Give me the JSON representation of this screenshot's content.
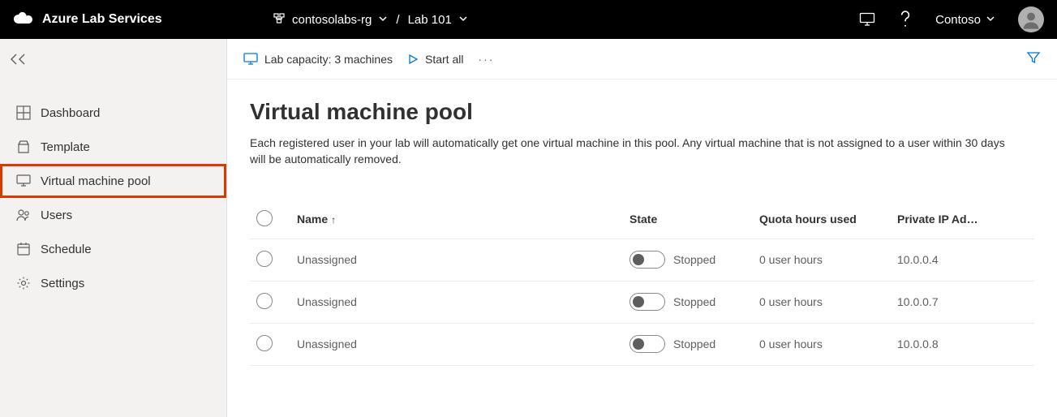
{
  "brand": "Azure Lab Services",
  "breadcrumb": {
    "rg": "contosolabs-rg",
    "lab": "Lab 101"
  },
  "org": "Contoso",
  "sidebar": {
    "items": [
      {
        "label": "Dashboard"
      },
      {
        "label": "Template"
      },
      {
        "label": "Virtual machine pool"
      },
      {
        "label": "Users"
      },
      {
        "label": "Schedule"
      },
      {
        "label": "Settings"
      }
    ]
  },
  "toolbar": {
    "capacity": "Lab capacity: 3 machines",
    "start_all": "Start all"
  },
  "page": {
    "title": "Virtual machine pool",
    "description": "Each registered user in your lab will automatically get one virtual machine in this pool. Any virtual machine that is not assigned to a user within 30 days will be automatically removed."
  },
  "table": {
    "headers": {
      "name": "Name",
      "state": "State",
      "quota": "Quota hours used",
      "ip": "Private IP Ad…"
    },
    "rows": [
      {
        "name": "Unassigned",
        "state": "Stopped",
        "quota": "0 user hours",
        "ip": "10.0.0.4"
      },
      {
        "name": "Unassigned",
        "state": "Stopped",
        "quota": "0 user hours",
        "ip": "10.0.0.7"
      },
      {
        "name": "Unassigned",
        "state": "Stopped",
        "quota": "0 user hours",
        "ip": "10.0.0.8"
      }
    ]
  }
}
